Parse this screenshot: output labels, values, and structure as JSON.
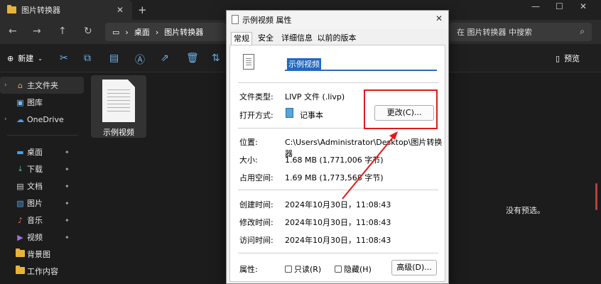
{
  "explorer": {
    "tab_title": "图片转换器",
    "breadcrumb": [
      "桌面",
      "图片转换器"
    ],
    "search_placeholder": "在 图片转换器 中搜索",
    "new_label": "新建",
    "preview_label": "预览",
    "no_preview": "没有预选。",
    "sidebar": {
      "home": "主文件夹",
      "gallery": "图库",
      "onedrive": "OneDrive",
      "desktop": "桌面",
      "downloads": "下载",
      "documents": "文档",
      "pictures": "图片",
      "music": "音乐",
      "videos": "视频",
      "folder1": "背景图",
      "folder2": "工作内容"
    },
    "file_name": "示例视频"
  },
  "dialog": {
    "title": "示例视频 属性",
    "tabs": [
      "常规",
      "安全",
      "详细信息",
      "以前的版本"
    ],
    "file_name": "示例视频",
    "file_type_label": "文件类型:",
    "file_type_value": "LIVP 文件 (.livp)",
    "open_with_label": "打开方式:",
    "open_with_value": "记事本",
    "change_button": "更改(C)...",
    "location_label": "位置:",
    "location_value": "C:\\Users\\Administrator\\Desktop\\图片转换器",
    "size_label": "大小:",
    "size_value": "1.68 MB (1,771,006 字节)",
    "size_on_disk_label": "占用空间:",
    "size_on_disk_value": "1.69 MB (1,773,568 字节)",
    "created_label": "创建时间:",
    "created_value": "2024年10月30日，11:08:43",
    "modified_label": "修改时间:",
    "modified_value": "2024年10月30日，11:08:43",
    "accessed_label": "访问时间:",
    "accessed_value": "2024年10月30日，11:08:43",
    "attributes_label": "属性:",
    "readonly_label": "只读(R)",
    "hidden_label": "隐藏(H)",
    "advanced_button": "高级(D)..."
  }
}
